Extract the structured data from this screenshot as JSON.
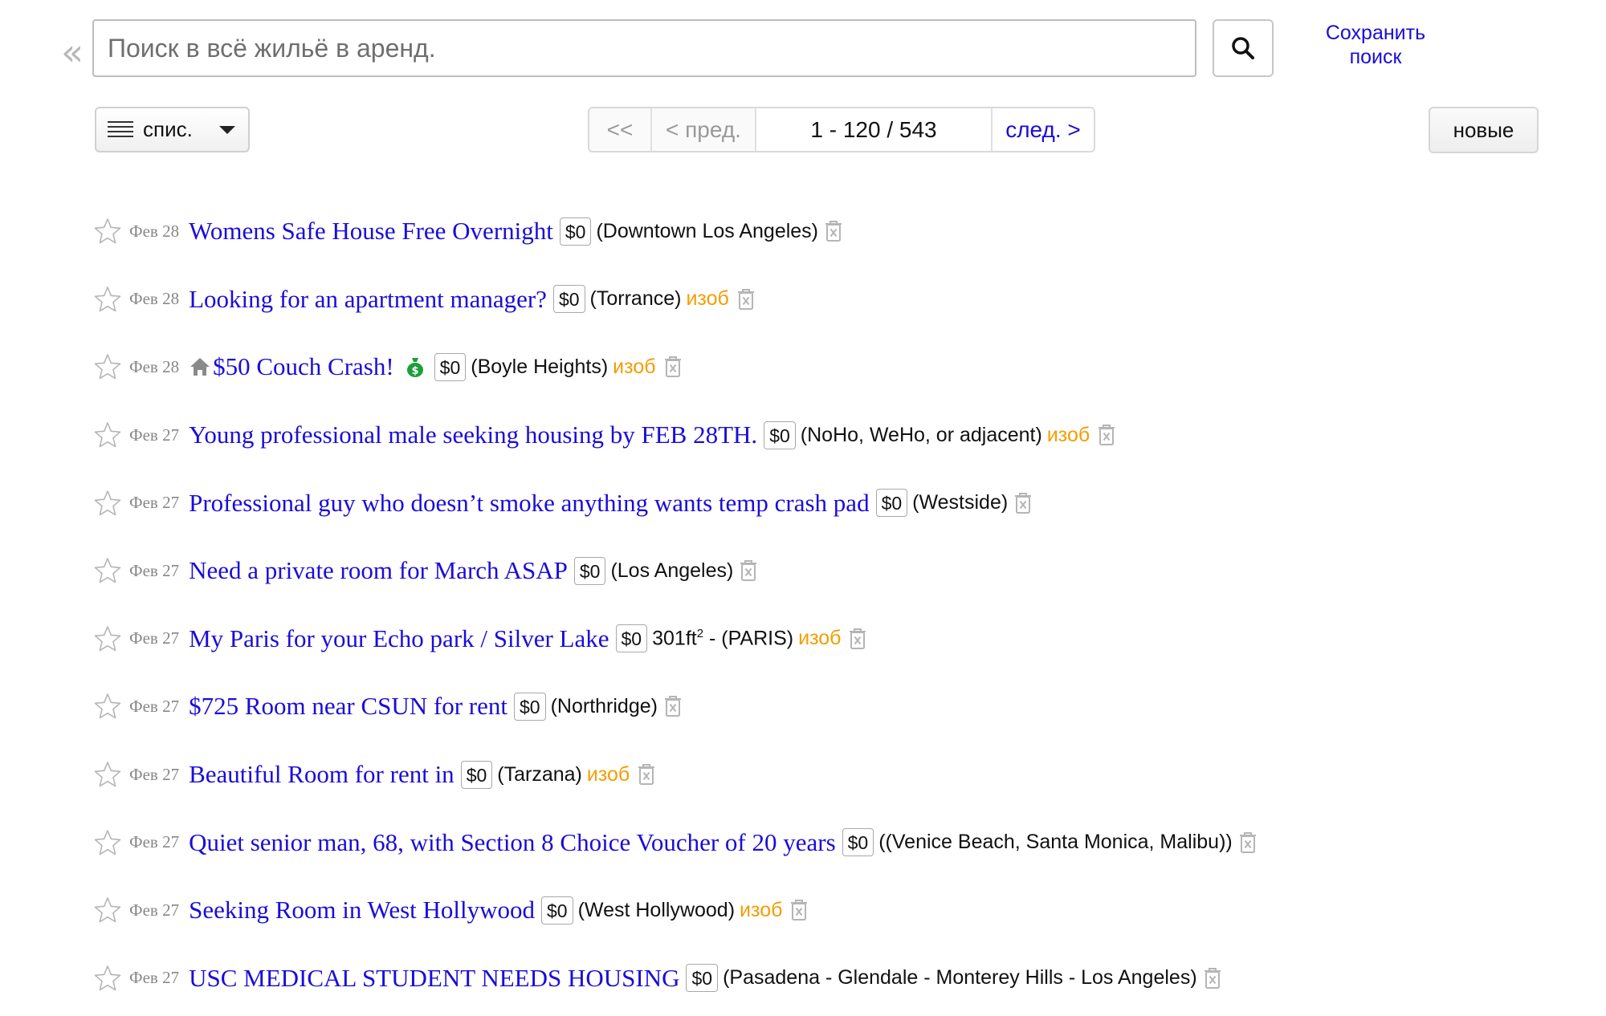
{
  "search": {
    "collapse_glyph": "«",
    "placeholder": "Поиск в всё жильё в аренд.",
    "save_line1": "Сохранить",
    "save_line2": "поиск"
  },
  "toolbar": {
    "view_label": "спис.",
    "pager_first": "<<",
    "pager_prev": "< пред.",
    "pager_range": "1 - 120 / 543",
    "pager_next": "след. >",
    "sort_label": "новые"
  },
  "colors": {
    "link": "#1a0dd9",
    "pic_tag": "#f59d00",
    "date": "#888888"
  },
  "listings": [
    {
      "date": "Фев 28",
      "title": "Womens Safe House Free Overnight",
      "price": "$0",
      "hood": "(Downtown Los Angeles)",
      "pic": ""
    },
    {
      "date": "Фев 28",
      "title": "Looking for an apartment manager?",
      "price": "$0",
      "hood": "(Torrance)",
      "pic": "изоб"
    },
    {
      "date": "Фев 28",
      "title": "$50 Couch Crash!",
      "price": "$0",
      "hood": "(Boyle Heights)",
      "pic": "изоб",
      "icons": [
        "house-icon",
        "money-bag-icon"
      ]
    },
    {
      "date": "Фев 27",
      "title": "Young professional male seeking housing by FEB 28TH.",
      "price": "$0",
      "hood": "(NoHo, WeHo, or adjacent)",
      "pic": "изоб"
    },
    {
      "date": "Фев 27",
      "title": "Professional guy who doesn’t smoke anything wants temp crash pad",
      "price": "$0",
      "hood": "(Westside)",
      "pic": ""
    },
    {
      "date": "Фев 27",
      "title": "Need a private room for March ASAP",
      "price": "$0",
      "hood": "(Los Angeles)",
      "pic": ""
    },
    {
      "date": "Фев 27",
      "title": "My Paris for your Echo park / Silver Lake",
      "price": "$0",
      "size": "301ft",
      "size_sup": "2",
      "hood": " - (PARIS)",
      "pic": "изоб"
    },
    {
      "date": "Фев 27",
      "title": "$725 Room near CSUN for rent",
      "price": "$0",
      "hood": "(Northridge)",
      "pic": ""
    },
    {
      "date": "Фев 27",
      "title": "Beautiful Room for rent in",
      "price": "$0",
      "hood": "(Tarzana)",
      "pic": "изоб"
    },
    {
      "date": "Фев 27",
      "title": "Quiet senior man, 68, with Section 8 Choice Voucher of 20 years",
      "price": "$0",
      "hood": "((Venice Beach, Santa Monica, Malibu))",
      "pic": ""
    },
    {
      "date": "Фев 27",
      "title": "Seeking Room in West Hollywood",
      "price": "$0",
      "hood": "(West Hollywood)",
      "pic": "изоб"
    },
    {
      "date": "Фев 27",
      "title": "USC MEDICAL STUDENT NEEDS HOUSING",
      "price": "$0",
      "hood": "(Pasadena - Glendale - Monterey Hills - Los Angeles)",
      "pic": ""
    }
  ]
}
